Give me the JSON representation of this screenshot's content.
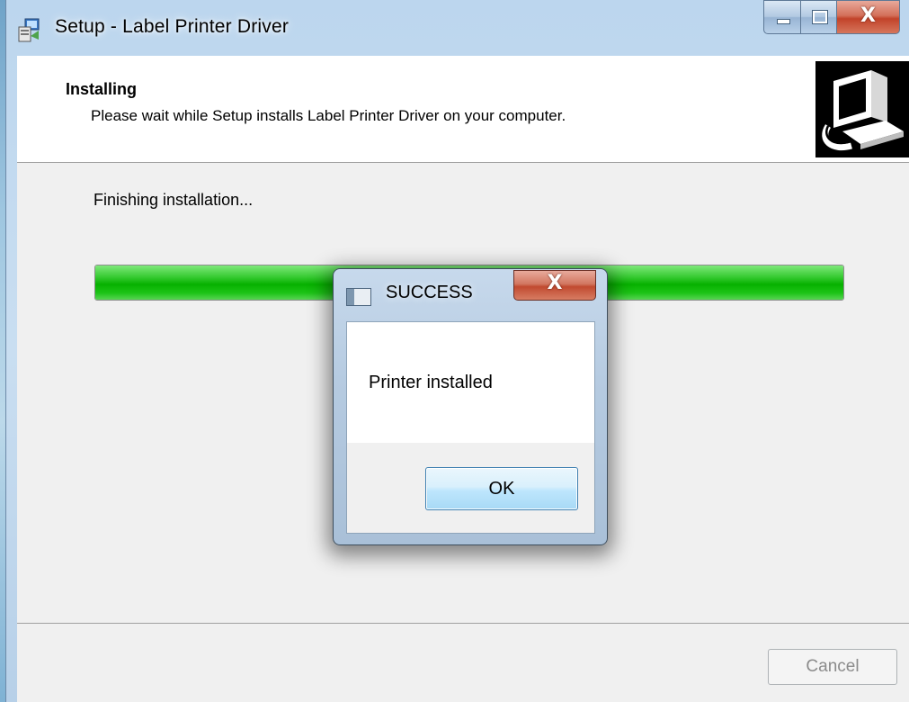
{
  "window": {
    "title": "Setup - Label Printer Driver",
    "close_glyph": "X"
  },
  "header": {
    "title": "Installing",
    "subtitle": "Please wait while Setup installs Label Printer Driver on your computer."
  },
  "main": {
    "status": "Finishing installation...",
    "progress_fraction": 1.0
  },
  "footer": {
    "cancel_label": "Cancel",
    "cancel_enabled": false
  },
  "dialog": {
    "title": "SUCCESS",
    "close_glyph": "X",
    "message": "Printer installed",
    "ok_label": "OK"
  },
  "colors": {
    "progress_green": "#07b100",
    "title_close_red": "#c2432a",
    "ok_button_border": "#3c7fb1"
  },
  "icons": {
    "app": "setup-computer-icon",
    "header_image": "computer-install-icon",
    "dialog": "window-icon"
  }
}
